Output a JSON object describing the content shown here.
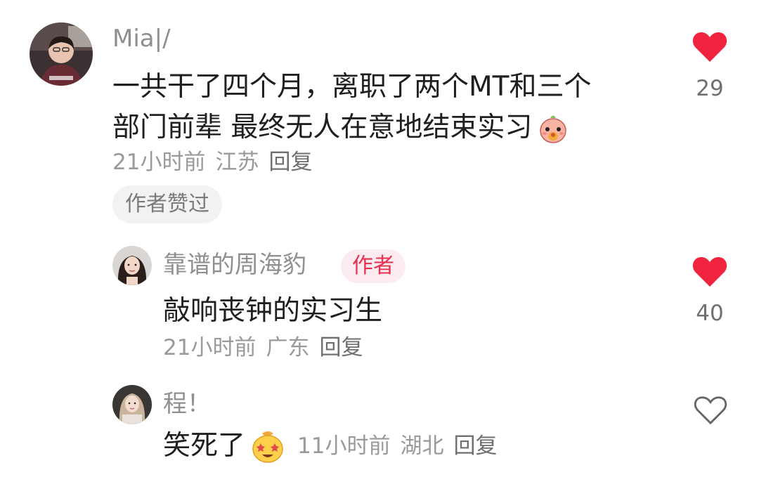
{
  "colors": {
    "like_active": "#f0243f",
    "like_inactive": "#666666",
    "author_badge_bg": "#fdecef",
    "author_badge_text": "#e8304f"
  },
  "comments": [
    {
      "username": "Mia|/",
      "text_line1": "一共干了四个月，离职了两个MT和三个",
      "text_line2": "部门前辈 最终无人在意地结束实习",
      "emoji": "peach-face-emoji",
      "time": "21小时前",
      "location": "江苏",
      "reply_label": "回复",
      "author_liked_label": "作者赞过",
      "likes": "29",
      "liked": true
    }
  ],
  "replies": [
    {
      "username": "靠谱的周海豹",
      "badge": "作者",
      "text": "敲响丧钟的实习生",
      "time": "21小时前",
      "location": "广东",
      "reply_label": "回复",
      "likes": "40",
      "liked": true
    },
    {
      "username": "程！",
      "text": "笑死了",
      "emoji": "starry-eyes-emoji",
      "time": "11小时前",
      "location": "湖北",
      "reply_label": "回复",
      "liked": false
    }
  ]
}
